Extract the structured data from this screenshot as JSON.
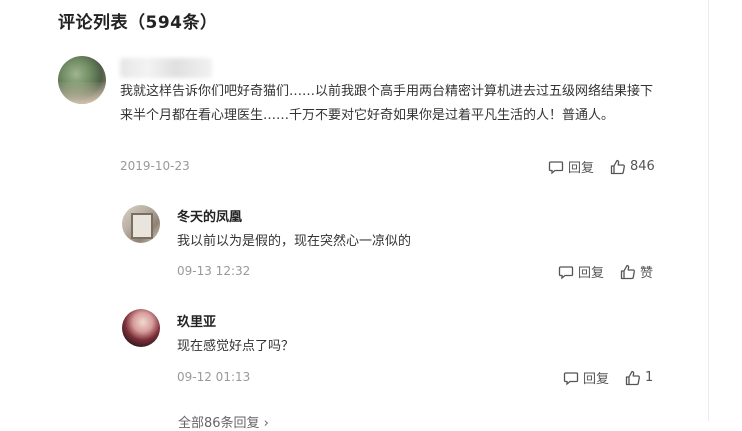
{
  "header": {
    "title": "评论列表（594条）"
  },
  "comment": {
    "text": "我就这样告诉你们吧好奇猫们……以前我跟个高手用两台精密计算机进去过五级网络结果接下来半个月都在看心理医生……千万不要对它好奇如果你是过着平凡生活的人！普通人。",
    "date": "2019-10-23",
    "reply_label": "回复",
    "like_count": "846"
  },
  "replies": [
    {
      "name": "冬天的凤凰",
      "text": "我以前以为是假的，现在突然心一凉似的",
      "date": "09-13 12:32",
      "reply_label": "回复",
      "like_label": "赞"
    },
    {
      "name": "玖里亚",
      "text": "现在感觉好点了吗？",
      "date": "09-12 01:13",
      "reply_label": "回复",
      "like_label": "1"
    }
  ],
  "more_replies": "全部86条回复 ›"
}
